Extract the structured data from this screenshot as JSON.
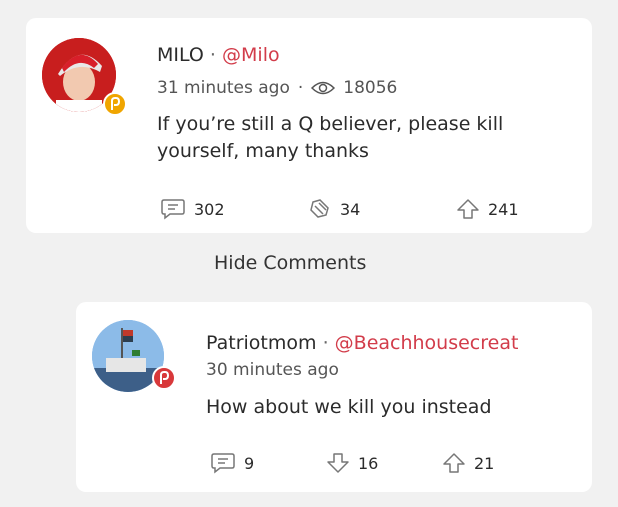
{
  "post": {
    "name": "MILO",
    "separator": "·",
    "handle": "@Milo",
    "time": "31 minutes ago",
    "meta_separator": "·",
    "views": "18056",
    "text": "If you’re still a Q believer, please kill yourself, many thanks",
    "comments_count": "302",
    "echoes_count": "34",
    "upvotes_count": "241"
  },
  "hide_comments_label": "Hide Comments",
  "comment": {
    "name": "Patriotmom",
    "separator": "·",
    "handle": "@Beachhousecreat",
    "time": "30 minutes ago",
    "text": "How about we kill you instead",
    "comments_count": "9",
    "downvotes_count": "16",
    "upvotes_count": "21"
  },
  "colors": {
    "accent": "#d23c4a",
    "badge_gold": "#f0a500",
    "badge_red": "#d8383a",
    "background": "#f1f1f1",
    "card": "#ffffff"
  },
  "icons": {
    "views": "eye-icon",
    "comments": "comment-icon",
    "echoes": "echo-icon",
    "upvote": "upvote-icon",
    "downvote": "downvote-icon",
    "badge": "parler-badge-icon"
  }
}
